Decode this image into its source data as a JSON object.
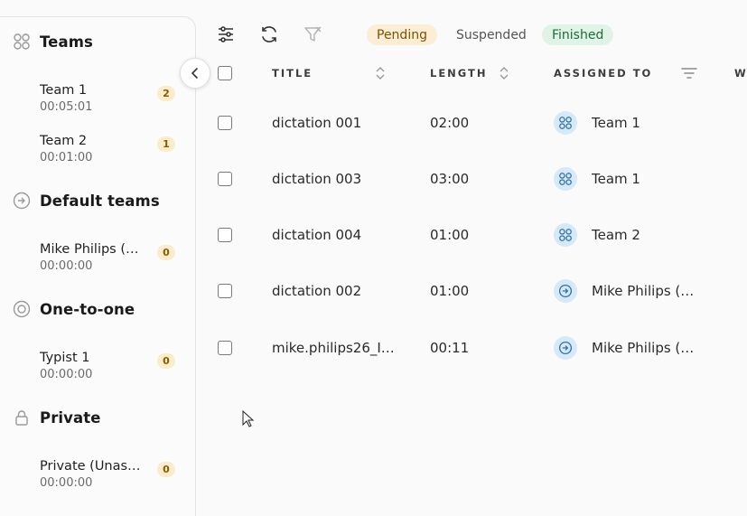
{
  "sidebar": {
    "sections": [
      {
        "title": "Teams",
        "icon": "teams-icon",
        "items": [
          {
            "name": "Team 1",
            "time": "00:05:01",
            "count": "2"
          },
          {
            "name": "Team 2",
            "time": "00:01:00",
            "count": "1"
          }
        ]
      },
      {
        "title": "Default teams",
        "icon": "arrow-circle-icon",
        "items": [
          {
            "name": "Mike Philips (Unassigned)",
            "display": "Mike Philips (…",
            "time": "00:00:00",
            "count": "0"
          }
        ]
      },
      {
        "title": "One-to-one",
        "icon": "target-circle-icon",
        "items": [
          {
            "name": "Typist 1",
            "time": "00:00:00",
            "count": "0"
          }
        ]
      },
      {
        "title": "Private",
        "icon": "lock-icon",
        "items": [
          {
            "name": "Private (Unassigned)",
            "display": "Private (Unas…",
            "time": "00:00:00",
            "count": "0"
          }
        ]
      }
    ]
  },
  "filters": {
    "pending": "Pending",
    "suspended": "Suspended",
    "finished": "Finished"
  },
  "table": {
    "headers": {
      "title": "TITLE",
      "length": "LENGTH",
      "assigned": "ASSIGNED TO",
      "next": "W"
    },
    "rows": [
      {
        "title": "dictation 001",
        "length": "02:00",
        "assigned": "Team 1",
        "type": "team"
      },
      {
        "title": "dictation 003",
        "length": "03:00",
        "assigned": "Team 1",
        "type": "team"
      },
      {
        "title": "dictation 004",
        "length": "01:00",
        "assigned": "Team 2",
        "type": "team"
      },
      {
        "title": "dictation 002",
        "length": "01:00",
        "assigned": "Mike Philips (…",
        "type": "default"
      },
      {
        "title": "mike.philips26_I…",
        "length": "00:11",
        "assigned": "Mike Philips (…",
        "type": "default"
      }
    ]
  },
  "colors": {
    "accent": "#d6e9f8",
    "pendingBg": "#fbeed4",
    "finishedBg": "#dff4e6",
    "badgeBg": "#fbeccc"
  }
}
